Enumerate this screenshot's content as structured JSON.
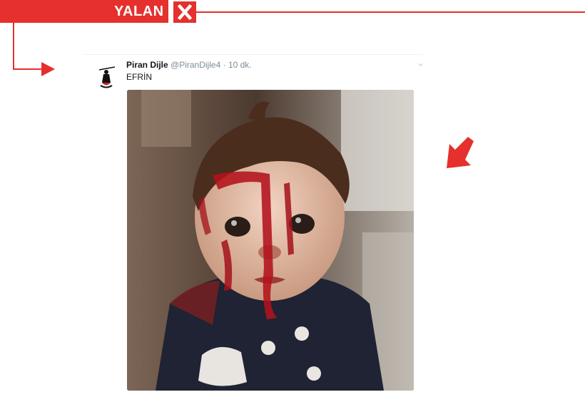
{
  "verdict": {
    "label": "YALAN",
    "color": "#e5302d",
    "icon": "close-icon"
  },
  "tweet": {
    "author_name": "Piran Dijle",
    "handle": "@PiranDijle4",
    "separator": "·",
    "timestamp": "10 dk.",
    "text": "EFRİN",
    "avatar_icon": "avatar-silhouette",
    "menu_icon": "chevron-down-icon",
    "image_subject": "photo-of-child"
  },
  "annotations": {
    "connector_arrow_icon": "arrow-right-icon",
    "pointer_arrow_icon": "arrow-down-left-icon",
    "color": "#e5302d"
  }
}
